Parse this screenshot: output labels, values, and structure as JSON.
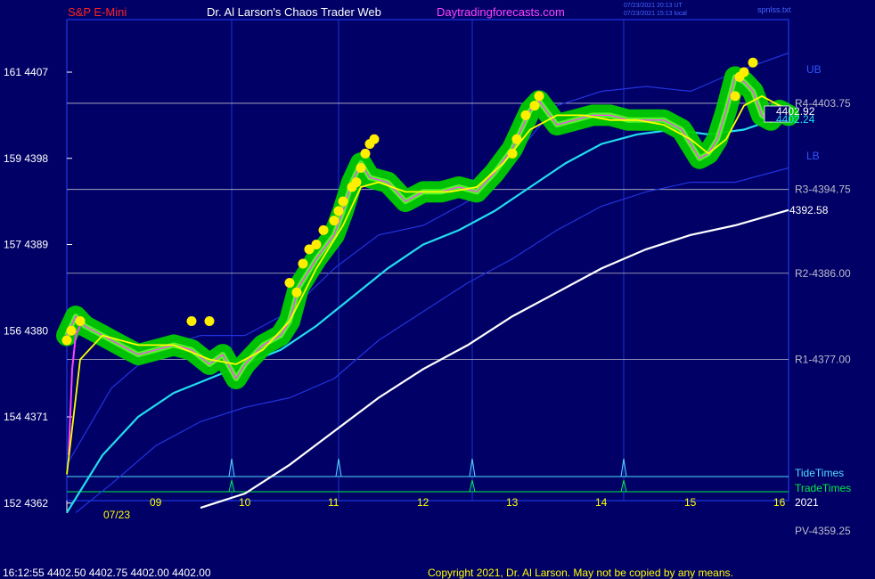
{
  "header": {
    "symbol": "S&P E-Mini",
    "title": "Dr. Al Larson's Chaos Trader Web",
    "site": "Daytradingforecasts.com",
    "timestamp_ut": "07/23/2021 20:13 UT",
    "timestamp_local": "07/23/2021 15:13 local",
    "file": "spnlss.txt"
  },
  "footer": {
    "quote": "16:12:55  4402.50 4402.75 4402.00 4402.00",
    "copyright": "Copyright 2021, Dr. Al Larson. May not be copied by any means."
  },
  "colors": {
    "background": "#000066",
    "frame": "#2244ff",
    "price_green": "#00cc00",
    "price_yellow": "#ffff00",
    "magenta": "#ff44ff",
    "cyan": "#22ddee",
    "blue_band": "#2233dd",
    "white_line": "#ffffff",
    "tide": "#55ddff",
    "trade": "#00ee44",
    "red_text": "#ff2222",
    "site_text": "#ff44ff"
  },
  "chart_data": {
    "type": "line",
    "y_ticks": [
      {
        "price": 4407,
        "label": "161  4407"
      },
      {
        "price": 4398,
        "label": "159  4398"
      },
      {
        "price": 4389,
        "label": "157  4389"
      },
      {
        "price": 4380,
        "label": "156  4380"
      },
      {
        "price": 4371,
        "label": "154  4371"
      },
      {
        "price": 4362,
        "label": "152  4362"
      }
    ],
    "ylim": [
      4362,
      4413
    ],
    "x_ticks": [
      {
        "hour": 9,
        "label": "09"
      },
      {
        "hour": 10,
        "label": "10"
      },
      {
        "hour": 11,
        "label": "11"
      },
      {
        "hour": 12,
        "label": "12"
      },
      {
        "hour": 13,
        "label": "13"
      },
      {
        "hour": 14,
        "label": "14"
      },
      {
        "hour": 15,
        "label": "15"
      },
      {
        "hour": 16,
        "label": "16"
      }
    ],
    "xlim": [
      8.0,
      16.1
    ],
    "date_label": "07/23",
    "year_label": "2021",
    "levels": [
      {
        "name": "R4",
        "price": 4403.75,
        "label": "R4-4403.75"
      },
      {
        "name": "R3",
        "price": 4394.75,
        "label": "R3-4394.75"
      },
      {
        "name": "R2",
        "price": 4386.0,
        "label": "R2-4386.00"
      },
      {
        "name": "R1",
        "price": 4377.0,
        "label": "R1-4377.00"
      }
    ],
    "band_labels": {
      "upper": "UB",
      "lower": "LB"
    },
    "pivot_label": "PV-4359.25",
    "last_price_labels": [
      "4402.92",
      "4402.24",
      "4392.58"
    ],
    "vertical_lines": [
      9.85,
      11.05,
      12.55,
      14.25
    ],
    "tide_times": {
      "label": "TideTimes",
      "spikes": [
        9.85,
        11.05,
        12.55,
        14.25
      ]
    },
    "trade_times": {
      "label": "TradeTimes",
      "spikes": [
        9.85,
        12.55,
        14.25
      ]
    },
    "series": [
      {
        "name": "price",
        "x": [
          8.0,
          8.1,
          8.2,
          8.4,
          8.6,
          8.8,
          9.0,
          9.2,
          9.4,
          9.6,
          9.75,
          9.9,
          10.0,
          10.2,
          10.4,
          10.5,
          10.6,
          10.8,
          11.0,
          11.1,
          11.2,
          11.3,
          11.4,
          11.6,
          11.8,
          12.0,
          12.2,
          12.4,
          12.6,
          12.8,
          13.0,
          13.2,
          13.3,
          13.5,
          13.7,
          13.9,
          14.1,
          14.3,
          14.5,
          14.7,
          14.9,
          15.1,
          15.2,
          15.3,
          15.4,
          15.5,
          15.6,
          15.7,
          15.8,
          15.9,
          16.0,
          16.1
        ],
        "y": [
          4379.5,
          4381.5,
          4380.5,
          4379.5,
          4378.5,
          4377.5,
          4378.0,
          4378.5,
          4378.0,
          4376.5,
          4377.5,
          4375.0,
          4376.5,
          4378.5,
          4379.5,
          4381.0,
          4384.5,
          4387.5,
          4390.0,
          4392.5,
          4395.5,
          4397.5,
          4396.0,
          4395.5,
          4393.5,
          4394.5,
          4394.5,
          4395.0,
          4394.5,
          4396.5,
          4399.0,
          4403.0,
          4404.0,
          4401.5,
          4402.0,
          4402.5,
          4402.5,
          4402.0,
          4402.0,
          4402.0,
          4401.0,
          4398.0,
          4398.5,
          4400.0,
          4403.0,
          4406.5,
          4406.0,
          4405.0,
          4402.5,
          4402.0,
          4403.0,
          4402.5
        ]
      },
      {
        "name": "yellow",
        "x": [
          8.0,
          8.15,
          8.4,
          8.8,
          9.2,
          9.6,
          9.9,
          10.2,
          10.5,
          10.8,
          11.1,
          11.3,
          11.5,
          11.8,
          12.0,
          12.3,
          12.6,
          12.9,
          13.2,
          13.5,
          13.8,
          14.1,
          14.4,
          14.7,
          15.0,
          15.2,
          15.4,
          15.6,
          15.8,
          16.0,
          16.1
        ],
        "y": [
          4365.0,
          4377.0,
          4379.5,
          4378.5,
          4378.5,
          4377.0,
          4376.5,
          4378.0,
          4381.0,
          4386.5,
          4391.0,
          4395.0,
          4395.5,
          4394.5,
          4394.5,
          4394.5,
          4395.0,
          4397.5,
          4401.0,
          4402.5,
          4402.5,
          4402.0,
          4402.0,
          4401.5,
          4400.0,
          4398.5,
          4400.0,
          4403.5,
          4404.5,
          4403.5,
          4403.2
        ]
      },
      {
        "name": "cyan",
        "x": [
          8.0,
          8.4,
          8.8,
          9.2,
          9.6,
          10.0,
          10.4,
          10.8,
          11.2,
          11.6,
          12.0,
          12.4,
          12.8,
          13.2,
          13.6,
          14.0,
          14.4,
          14.8,
          15.2,
          15.6,
          16.1
        ],
        "y": [
          4361.0,
          4367.0,
          4371.0,
          4373.5,
          4375.0,
          4376.5,
          4378.0,
          4380.5,
          4383.5,
          4386.5,
          4389.0,
          4390.5,
          4392.5,
          4395.0,
          4397.5,
          4399.5,
          4400.5,
          4401.0,
          4400.5,
          4401.0,
          4402.6
        ]
      },
      {
        "name": "white",
        "x": [
          9.5,
          10.0,
          10.5,
          11.0,
          11.5,
          12.0,
          12.5,
          13.0,
          13.5,
          14.0,
          14.5,
          15.0,
          15.5,
          16.1
        ],
        "y": [
          4361.5,
          4363.0,
          4366.0,
          4369.5,
          4373.0,
          4376.0,
          4378.5,
          4381.5,
          4384.0,
          4386.5,
          4388.5,
          4390.0,
          4391.0,
          4392.6
        ]
      },
      {
        "name": "upper band",
        "x": [
          8.0,
          8.5,
          9.0,
          9.5,
          10.0,
          10.5,
          11.0,
          11.5,
          12.0,
          12.5,
          13.0,
          13.5,
          14.0,
          14.5,
          15.0,
          15.5,
          16.1
        ],
        "y": [
          4366.0,
          4374.0,
          4378.0,
          4379.5,
          4379.5,
          4382.0,
          4386.5,
          4390.0,
          4391.0,
          4393.5,
          4398.0,
          4403.5,
          4405.0,
          4405.5,
          4405.0,
          4407.0,
          4409.0
        ]
      },
      {
        "name": "lower band",
        "x": [
          8.1,
          8.5,
          9.0,
          9.5,
          10.0,
          10.5,
          11.0,
          11.5,
          12.0,
          12.5,
          13.0,
          13.5,
          14.0,
          14.5,
          15.0,
          15.5,
          16.1
        ],
        "y": [
          4361.0,
          4364.0,
          4368.0,
          4370.5,
          4372.0,
          4373.0,
          4375.0,
          4379.0,
          4382.0,
          4385.0,
          4387.5,
          4390.5,
          4393.0,
          4394.5,
          4395.5,
          4395.5,
          4397.0
        ]
      },
      {
        "name": "early magenta",
        "x": [
          8.02,
          8.06,
          8.1,
          8.15
        ],
        "y": [
          4367.0,
          4376.0,
          4379.5,
          4380.5
        ]
      }
    ],
    "markers": {
      "name": "yellow dots",
      "x": [
        8.0,
        8.05,
        8.15,
        9.4,
        9.6,
        10.5,
        10.58,
        10.65,
        10.72,
        10.8,
        10.88,
        11.0,
        11.05,
        11.1,
        11.2,
        11.25,
        11.3,
        11.35,
        11.4,
        11.45,
        13.0,
        13.05,
        13.15,
        13.25,
        13.3,
        15.5,
        15.55,
        15.6,
        15.7
      ],
      "y": [
        4379.0,
        4380.0,
        4381.0,
        4381.0,
        4381.0,
        4385.0,
        4384.0,
        4387.0,
        4388.5,
        4389.0,
        4390.5,
        4391.5,
        4392.5,
        4393.5,
        4395.0,
        4395.5,
        4397.0,
        4398.5,
        4399.5,
        4400.0,
        4398.5,
        4400.0,
        4402.5,
        4403.5,
        4404.5,
        4404.5,
        4406.5,
        4407.0,
        4408.0
      ]
    }
  }
}
